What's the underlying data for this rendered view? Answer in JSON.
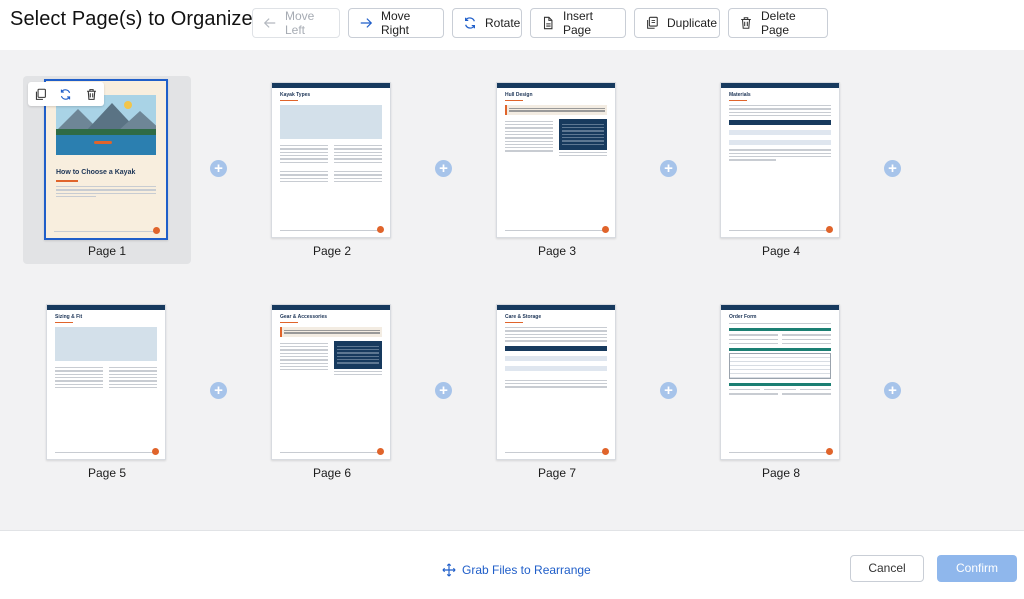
{
  "header": {
    "title": "Select Page(s) to Organize",
    "toolbar": {
      "move_left": "Move Left",
      "move_right": "Move Right",
      "rotate": "Rotate",
      "insert_page": "Insert Page",
      "duplicate": "Duplicate",
      "delete_page": "Delete Page"
    }
  },
  "pages": [
    {
      "label": "Page 1",
      "selected": true,
      "doc_title": "How to Choose a Kayak"
    },
    {
      "label": "Page 2",
      "selected": false,
      "doc_title": "Kayak Types"
    },
    {
      "label": "Page 3",
      "selected": false,
      "doc_title": "Hull Design"
    },
    {
      "label": "Page 4",
      "selected": false,
      "doc_title": "Materials"
    },
    {
      "label": "Page 5",
      "selected": false,
      "doc_title": "Sizing & Fit"
    },
    {
      "label": "Page 6",
      "selected": false,
      "doc_title": "Gear & Accessories"
    },
    {
      "label": "Page 7",
      "selected": false,
      "doc_title": "Care & Storage"
    },
    {
      "label": "Page 8",
      "selected": false,
      "doc_title": "Order Form"
    }
  ],
  "insert_icon": "+",
  "footer": {
    "grab_label": "Grab Files to Rearrange",
    "cancel_label": "Cancel",
    "confirm_label": "Confirm"
  },
  "colors": {
    "accent": "#1f5ec9",
    "confirm_bg": "#8fb7ec",
    "insert_plus": "#a7c4ea",
    "doc_header": "#173a5e",
    "doc_accent": "#e0642b"
  }
}
